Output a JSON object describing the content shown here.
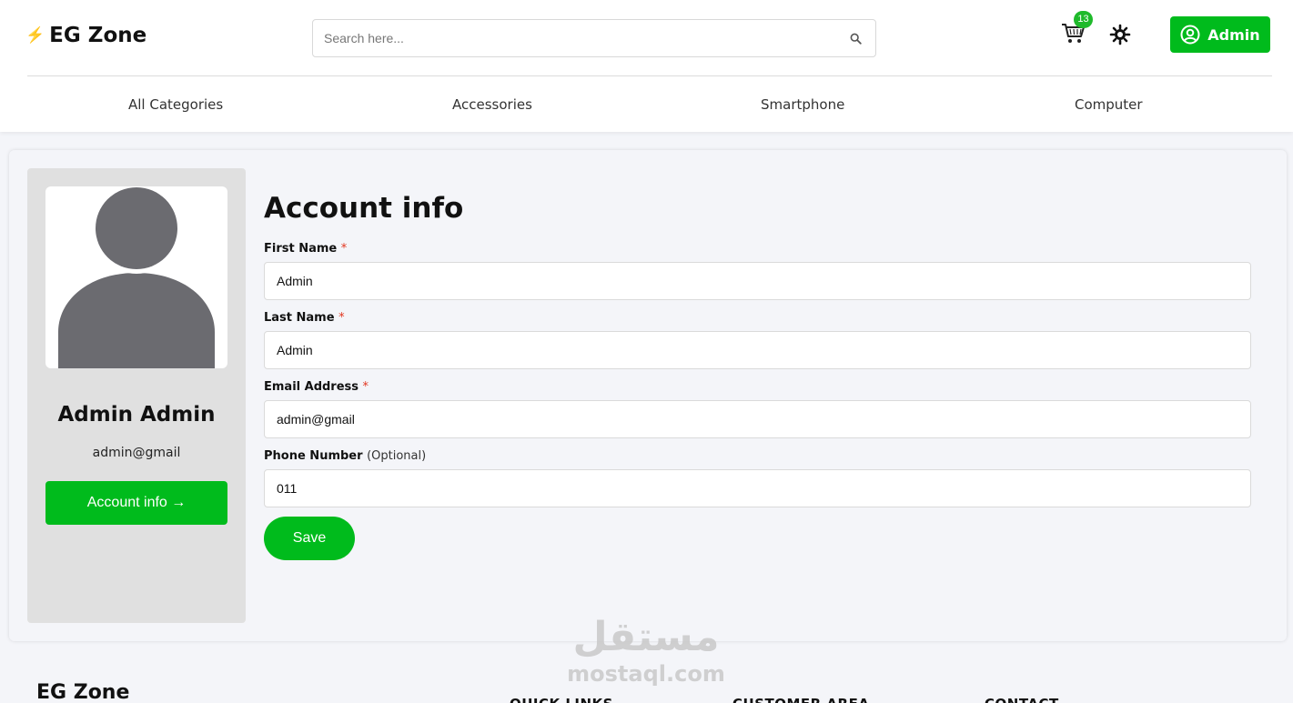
{
  "header": {
    "logo_text": "EG Zone",
    "search_placeholder": "Search here...",
    "cart_count": "13",
    "admin_button_label": "Admin"
  },
  "nav": {
    "items": [
      "All Categories",
      "Accessories",
      "Smartphone",
      "Computer"
    ]
  },
  "sidebar": {
    "name": "Admin Admin",
    "email": "admin@gmail",
    "account_button_label": "Account info →"
  },
  "form": {
    "title": "Account info",
    "required_mark": "*",
    "first_name_label": "First Name",
    "first_name_value": "Admin",
    "last_name_label": "Last Name",
    "last_name_value": "Admin",
    "email_label": "Email Address",
    "email_value": "admin@gmail",
    "phone_label": "Phone Number",
    "phone_optional": "(Optional)",
    "phone_value": "011",
    "save_label": "Save"
  },
  "footer": {
    "logo_text": "EG Zone",
    "headings": [
      "QUICK LINKS",
      "CUSTOMER AREA",
      "CONTACT"
    ]
  },
  "watermark": {
    "arabic": "مستقل",
    "latin": "mostaql.com"
  },
  "colors": {
    "brand_green": "#00bb1c",
    "required_red": "#e2361f",
    "logo_bolt": "#f5b800"
  }
}
